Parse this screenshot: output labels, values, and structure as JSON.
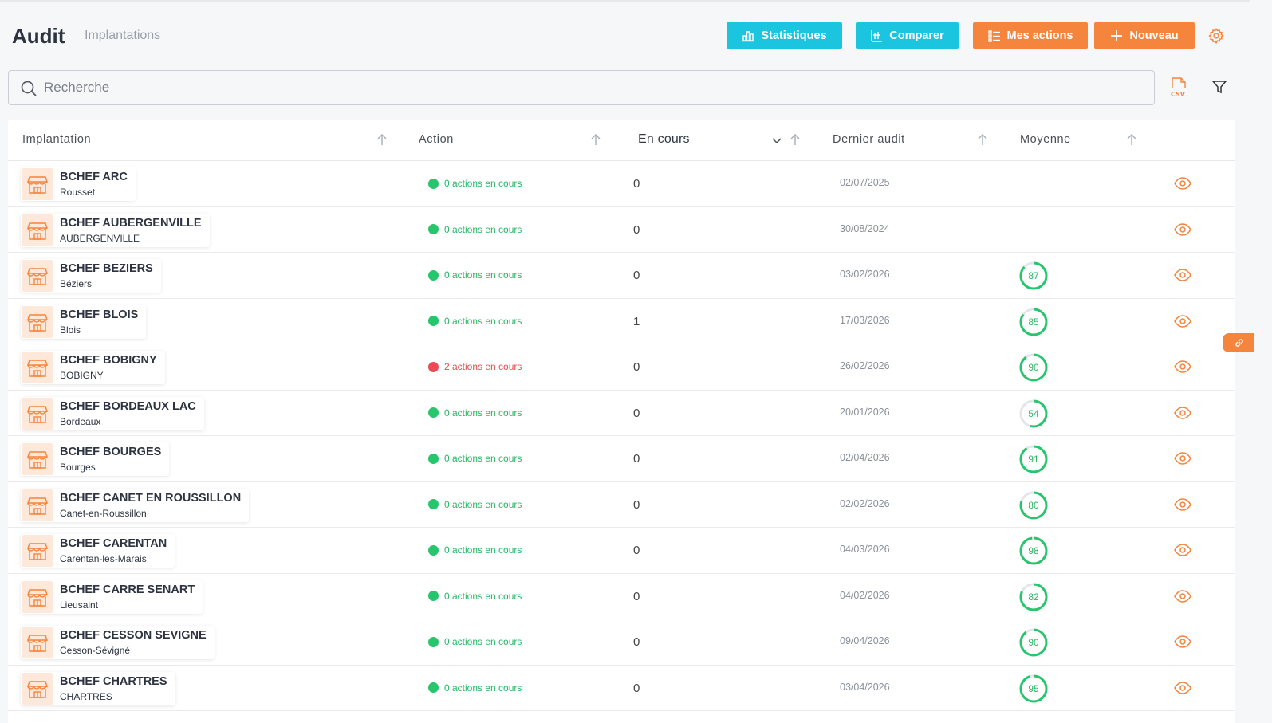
{
  "header": {
    "title": "Audit",
    "subtitle": "Implantations",
    "buttons": {
      "statistiques": "Statistiques",
      "comparer": "Comparer",
      "mes_actions": "Mes actions",
      "nouveau": "Nouveau"
    }
  },
  "search": {
    "placeholder": "Recherche",
    "value": ""
  },
  "colors": {
    "cyan": "#1bc5e0",
    "orange": "#f5843d",
    "green": "#27c56c",
    "red": "#eb4b55"
  },
  "icons": {
    "statistiques": "bar-chart-icon",
    "comparer": "compare-chart-icon",
    "mes_actions": "list-icon",
    "nouveau": "plus-icon",
    "settings": "gear-icon",
    "search": "search-icon",
    "export": "csv-file-icon",
    "filter": "filter-icon",
    "site": "store-icon",
    "view": "eye-icon",
    "side_tab": "link-icon"
  },
  "table": {
    "columns": {
      "implantation": "Implantation",
      "action": "Action",
      "en_cours": "En cours",
      "dernier_audit": "Dernier audit",
      "moyenne": "Moyenne"
    },
    "rows": [
      {
        "name": "BCHEF ARC",
        "city": "Rousset",
        "action_text": "0 actions en cours",
        "action_status": "ok",
        "en_cours": "0",
        "date": "02/07/2025",
        "moyenne": null
      },
      {
        "name": "BCHEF AUBERGENVILLE",
        "city": "AUBERGENVILLE",
        "action_text": "0 actions en cours",
        "action_status": "ok",
        "en_cours": "0",
        "date": "30/08/2024",
        "moyenne": null
      },
      {
        "name": "BCHEF BEZIERS",
        "city": "Béziers",
        "action_text": "0 actions en cours",
        "action_status": "ok",
        "en_cours": "0",
        "date": "03/02/2026",
        "moyenne": 87
      },
      {
        "name": "BCHEF BLOIS",
        "city": "Blois",
        "action_text": "0 actions en cours",
        "action_status": "ok",
        "en_cours": "1",
        "date": "17/03/2026",
        "moyenne": 85
      },
      {
        "name": "BCHEF BOBIGNY",
        "city": "BOBIGNY",
        "action_text": "2 actions en cours",
        "action_status": "ko",
        "en_cours": "0",
        "date": "26/02/2026",
        "moyenne": 90
      },
      {
        "name": "BCHEF BORDEAUX LAC",
        "city": "Bordeaux",
        "action_text": "0 actions en cours",
        "action_status": "ok",
        "en_cours": "0",
        "date": "20/01/2026",
        "moyenne": 54
      },
      {
        "name": "BCHEF BOURGES",
        "city": "Bourges",
        "action_text": "0 actions en cours",
        "action_status": "ok",
        "en_cours": "0",
        "date": "02/04/2026",
        "moyenne": 91
      },
      {
        "name": "BCHEF CANET EN ROUSSILLON",
        "city": "Canet-en-Roussillon",
        "action_text": "0 actions en cours",
        "action_status": "ok",
        "en_cours": "0",
        "date": "02/02/2026",
        "moyenne": 80
      },
      {
        "name": "BCHEF CARENTAN",
        "city": "Carentan-les-Marais",
        "action_text": "0 actions en cours",
        "action_status": "ok",
        "en_cours": "0",
        "date": "04/03/2026",
        "moyenne": 98
      },
      {
        "name": "BCHEF CARRE SENART",
        "city": "Lieusaint",
        "action_text": "0 actions en cours",
        "action_status": "ok",
        "en_cours": "0",
        "date": "04/02/2026",
        "moyenne": 82
      },
      {
        "name": "BCHEF CESSON SEVIGNE",
        "city": "Cesson-Sévigné",
        "action_text": "0 actions en cours",
        "action_status": "ok",
        "en_cours": "0",
        "date": "09/04/2026",
        "moyenne": 90
      },
      {
        "name": "BCHEF CHARTRES",
        "city": "CHARTRES",
        "action_text": "0 actions en cours",
        "action_status": "ok",
        "en_cours": "0",
        "date": "03/04/2026",
        "moyenne": 95
      }
    ]
  }
}
